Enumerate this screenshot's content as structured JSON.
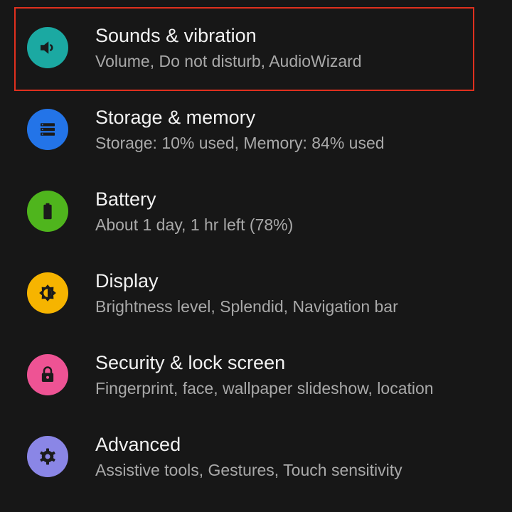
{
  "settings": {
    "items": [
      {
        "title": "Sounds & vibration",
        "subtitle": "Volume, Do not disturb, AudioWizard",
        "icon": "speaker-icon",
        "color": "#1ba9a2"
      },
      {
        "title": "Storage & memory",
        "subtitle": "Storage: 10% used, Memory: 84% used",
        "icon": "storage-icon",
        "color": "#2374e8"
      },
      {
        "title": "Battery",
        "subtitle": "About 1 day, 1 hr left (78%)",
        "icon": "battery-icon",
        "color": "#4fb51d"
      },
      {
        "title": "Display",
        "subtitle": "Brightness level, Splendid, Navigation bar",
        "icon": "brightness-icon",
        "color": "#f6b400"
      },
      {
        "title": "Security & lock screen",
        "subtitle": "Fingerprint, face, wallpaper slideshow, location",
        "icon": "lock-icon",
        "color": "#ee5394"
      },
      {
        "title": "Advanced",
        "subtitle": "Assistive tools, Gestures, Touch sensitivity",
        "icon": "gear-icon",
        "color": "#8a86e6"
      }
    ]
  },
  "highlight": {
    "color": "#e0301e",
    "target": "Sounds & vibration"
  }
}
